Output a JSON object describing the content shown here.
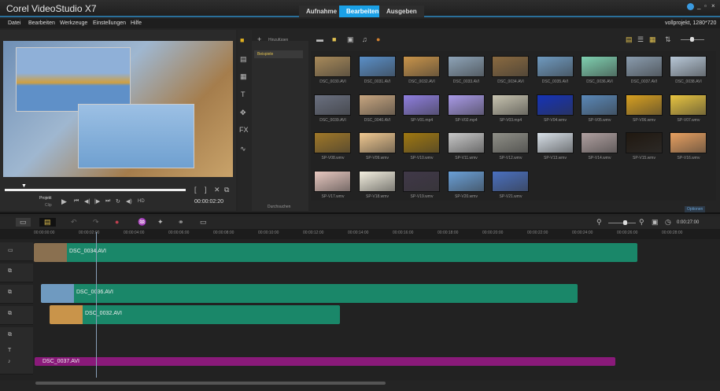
{
  "app": {
    "title": "Corel VideoStudio X7",
    "project_info": "vollprojekt, 1280*720"
  },
  "tabs": [
    {
      "label": "Aufnahme"
    },
    {
      "label": "Bearbeiten",
      "active": true
    },
    {
      "label": "Ausgeben"
    }
  ],
  "menu": [
    "Datei",
    "Bearbeiten",
    "Werkzeuge",
    "Einstellungen",
    "Hilfe"
  ],
  "preview": {
    "mode_project": "Projekt",
    "mode_clip": "Clip",
    "timecode": "00:00:02:20",
    "hd": "HD",
    "position_fraction": 0.11
  },
  "library": {
    "add_label": "Hinzufügen",
    "folder": "Beispiele",
    "browse_label": "Durchsuchen",
    "options_label": "Optionen",
    "items": [
      "DSC_0030.AVI",
      "DSC_0031.AVI",
      "DSC_0032.AVI",
      "DSC_0033.AVI",
      "DSC_0034.AVI",
      "DSC_0035.AVI",
      "DSC_0036.AVI",
      "DSC_0037.AVI",
      "DSC_0038.AVI",
      "DSC_0039.AVI",
      "DSC_0040.AVI",
      "SP-V01.mp4",
      "SP-V02.mp4",
      "SP-V03.mp4",
      "SP-V04.wmv",
      "SP-V05.wmv",
      "SP-V06.wmv",
      "SP-V07.wmv",
      "SP-V08.wmv",
      "SP-V09.wmv",
      "SP-V10.wmv",
      "SP-V11.wmv",
      "SP-V12.wmv",
      "SP-V13.wmv",
      "SP-V14.wmv",
      "SP-V15.wmv",
      "SP-V16.wmv",
      "SP-V17.wmv",
      "SP-V18.wmv",
      "SP-V19.wmv",
      "SP-V20.wmv",
      "SP-V21.wmv"
    ],
    "colors": [
      "#a88a5a",
      "#5a8fc8",
      "#c9944a",
      "#8ea4b8",
      "#8a6a40",
      "#6f9ac0",
      "#7fd0b0",
      "#8a9cae",
      "#b8c8d8",
      "#6a7080",
      "#c8a680",
      "#8f7fe0",
      "#a99ae8",
      "#c8c4b0",
      "#1533b8",
      "#5a88b8",
      "#d8a020",
      "#e8c440",
      "#a07828",
      "#f0c890",
      "#a07810",
      "#c8c8c8",
      "#909088",
      "#d8e0e8",
      "#b0a0a0",
      "#201810",
      "#e8a060",
      "#e8c8c0",
      "#f4f0e0",
      "#403848",
      "#6aa0d8",
      "#4a70c0"
    ]
  },
  "timeline": {
    "timecode": "0:00:27:00",
    "ruler": [
      "00:00:00:00",
      "00:00:02:00",
      "00:00:04:00",
      "00:00:06:00",
      "00:00:08:00",
      "00:00:10:00",
      "00:00:12:00",
      "00:00:14:00",
      "00:00:16:00",
      "00:00:18:00",
      "00:00:20:00",
      "00:00:22:00",
      "00:00:24:00",
      "00:00:26:00",
      "00:00:28:00"
    ],
    "clips": {
      "video": "DSC_0034.AVI",
      "overlay1": "DSC_0036.AVI",
      "overlay2": "DSC_0032.AVI",
      "music": "DSC_0037.AVI"
    },
    "colors": {
      "video_clip": "#1a8769",
      "music_clip": "#8a1a7a",
      "accent": "#1aa0e6"
    }
  }
}
